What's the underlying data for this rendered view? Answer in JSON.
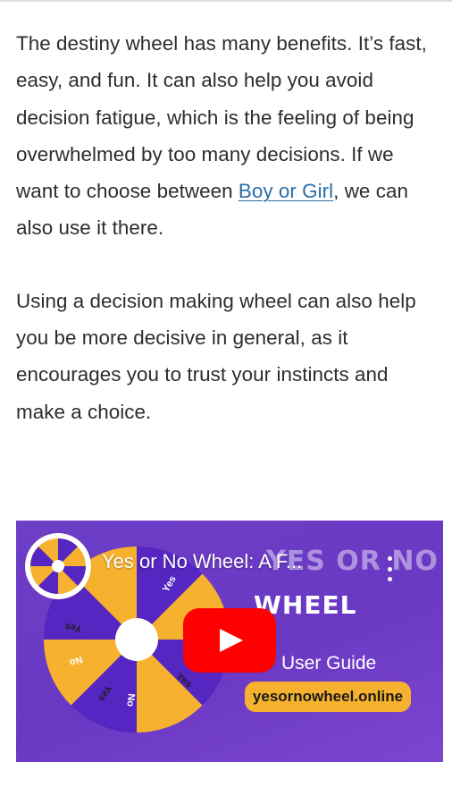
{
  "article": {
    "p1_before_link": "The destiny wheel has many benefits. It’s fast, easy, and fun. It can also help you avoid decision fatigue, which is the feeling of being overwhelmed by too many decisions. If we want to choose between ",
    "p1_link": "Boy or Girl",
    "p1_after_link": ", we can also use it there.",
    "p2": "Using a decision making wheel can also help you be more decisive in general, as it encourages you to trust your instincts and make a choice."
  },
  "video": {
    "title": "Yes or No Wheel: A F...",
    "brand_line1": "YES OR NO",
    "brand_line2": "WHEEL",
    "subtitle": "User Guide",
    "site": "yesornowheel.online",
    "wheel_labels": [
      "Yes",
      "No",
      "Yes",
      "No",
      "Yes",
      "No",
      "Yes"
    ],
    "colors": {
      "purple": "#6a39c4",
      "orange": "#f6b22e",
      "play_red": "#ff0000",
      "link_blue": "#2a6ea8"
    },
    "icons": [
      "channel-avatar-icon",
      "more-vert-icon",
      "play-icon"
    ]
  }
}
